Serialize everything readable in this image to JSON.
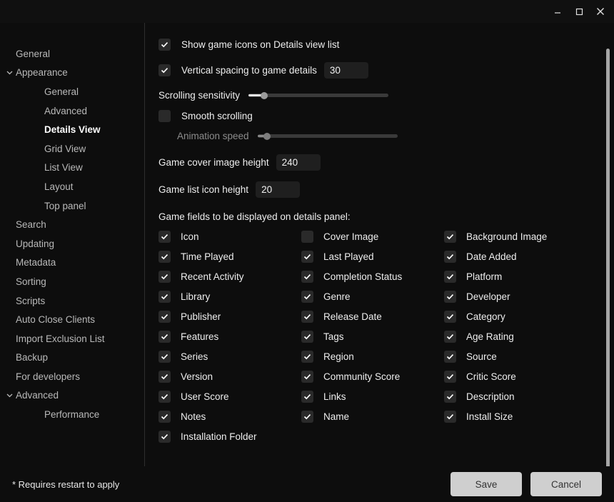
{
  "window": {
    "minimize_icon": "minimize-icon",
    "maximize_icon": "maximize-icon",
    "close_icon": "close-icon"
  },
  "sidebar": {
    "items": [
      {
        "label": "General",
        "level": 0,
        "chevron": false,
        "active": false
      },
      {
        "label": "Appearance",
        "level": 0,
        "chevron": true,
        "active": false
      },
      {
        "label": "General",
        "level": 1,
        "chevron": false,
        "active": false
      },
      {
        "label": "Advanced",
        "level": 1,
        "chevron": false,
        "active": false
      },
      {
        "label": "Details View",
        "level": 1,
        "chevron": false,
        "active": true
      },
      {
        "label": "Grid View",
        "level": 1,
        "chevron": false,
        "active": false
      },
      {
        "label": "List View",
        "level": 1,
        "chevron": false,
        "active": false
      },
      {
        "label": "Layout",
        "level": 1,
        "chevron": false,
        "active": false
      },
      {
        "label": "Top panel",
        "level": 1,
        "chevron": false,
        "active": false
      },
      {
        "label": "Search",
        "level": 0,
        "chevron": false,
        "active": false
      },
      {
        "label": "Updating",
        "level": 0,
        "chevron": false,
        "active": false
      },
      {
        "label": "Metadata",
        "level": 0,
        "chevron": false,
        "active": false
      },
      {
        "label": "Sorting",
        "level": 0,
        "chevron": false,
        "active": false
      },
      {
        "label": "Scripts",
        "level": 0,
        "chevron": false,
        "active": false
      },
      {
        "label": "Auto Close Clients",
        "level": 0,
        "chevron": false,
        "active": false
      },
      {
        "label": "Import Exclusion List",
        "level": 0,
        "chevron": false,
        "active": false
      },
      {
        "label": "Backup",
        "level": 0,
        "chevron": false,
        "active": false
      },
      {
        "label": "For developers",
        "level": 0,
        "chevron": false,
        "active": false
      },
      {
        "label": "Advanced",
        "level": 0,
        "chevron": true,
        "active": false
      },
      {
        "label": "Performance",
        "level": 1,
        "chevron": false,
        "active": false
      }
    ]
  },
  "settings": {
    "show_game_icons": {
      "label": "Show game icons on Details view list",
      "checked": true
    },
    "vertical_spacing": {
      "label": "Vertical spacing to game details",
      "checked": true,
      "value": "30"
    },
    "scrolling_sensitivity": {
      "label": "Scrolling sensitivity",
      "percent": 11
    },
    "smooth_scrolling": {
      "label": "Smooth scrolling",
      "checked": false
    },
    "animation_speed": {
      "label": "Animation speed",
      "percent": 7,
      "disabled": true
    },
    "cover_image_height": {
      "label": "Game cover image height",
      "value": "240"
    },
    "list_icon_height": {
      "label": "Game list icon height",
      "value": "20"
    },
    "fields_section_title": "Game fields to be displayed on details panel:",
    "fields": [
      {
        "label": "Icon",
        "checked": true
      },
      {
        "label": "Cover Image",
        "checked": false
      },
      {
        "label": "Background Image",
        "checked": true
      },
      {
        "label": "Time Played",
        "checked": true
      },
      {
        "label": "Last Played",
        "checked": true
      },
      {
        "label": "Date Added",
        "checked": true
      },
      {
        "label": "Recent Activity",
        "checked": true
      },
      {
        "label": "Completion Status",
        "checked": true
      },
      {
        "label": "Platform",
        "checked": true
      },
      {
        "label": "Library",
        "checked": true
      },
      {
        "label": "Genre",
        "checked": true
      },
      {
        "label": "Developer",
        "checked": true
      },
      {
        "label": "Publisher",
        "checked": true
      },
      {
        "label": "Release Date",
        "checked": true
      },
      {
        "label": "Category",
        "checked": true
      },
      {
        "label": "Features",
        "checked": true
      },
      {
        "label": "Tags",
        "checked": true
      },
      {
        "label": "Age Rating",
        "checked": true
      },
      {
        "label": "Series",
        "checked": true
      },
      {
        "label": "Region",
        "checked": true
      },
      {
        "label": "Source",
        "checked": true
      },
      {
        "label": "Version",
        "checked": true
      },
      {
        "label": "Community Score",
        "checked": true
      },
      {
        "label": "Critic Score",
        "checked": true
      },
      {
        "label": "User Score",
        "checked": true
      },
      {
        "label": "Links",
        "checked": true
      },
      {
        "label": "Description",
        "checked": true
      },
      {
        "label": "Notes",
        "checked": true
      },
      {
        "label": "Name",
        "checked": true
      },
      {
        "label": "Install Size",
        "checked": true
      },
      {
        "label": "Installation Folder",
        "checked": true
      }
    ]
  },
  "footer": {
    "note": "* Requires restart to apply",
    "save_label": "Save",
    "cancel_label": "Cancel"
  },
  "colors": {
    "background": "#0d0d0d",
    "titlebar": "#101010",
    "accent_text": "#ffffff",
    "button": "#cfcfcf",
    "checkbox": "#2a2a2a"
  }
}
